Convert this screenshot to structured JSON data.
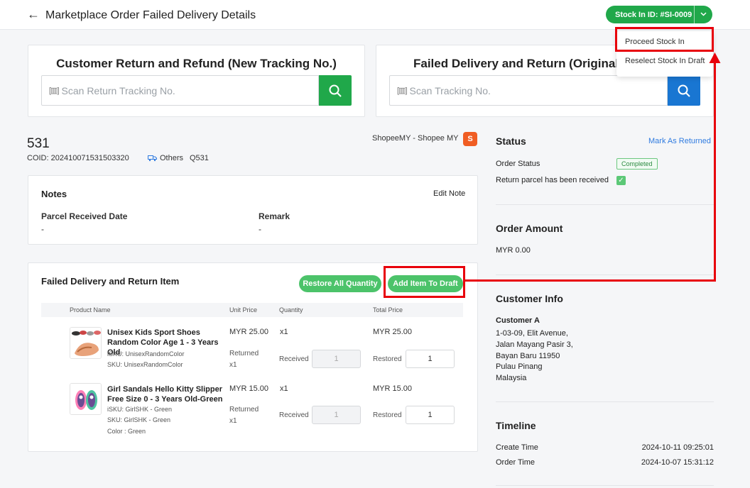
{
  "header": {
    "title": "Marketplace Order Failed Delivery Details",
    "stock_in_label": "Stock In ID: #SI-0009"
  },
  "dropdown": {
    "items": [
      "Proceed Stock In",
      "Reselect Stock In Draft"
    ]
  },
  "scan_left": {
    "title": "Customer Return and Refund (New Tracking No.)",
    "placeholder": "Scan Return Tracking No."
  },
  "scan_right": {
    "title": "Failed Delivery and Return (Original Tracking No.)",
    "placeholder": "Scan Tracking No."
  },
  "order": {
    "number": "531",
    "coid": "COID: 202410071531503320",
    "shipping": "Others",
    "ref": "Q531",
    "shop": "ShopeeMY - Shopee MY",
    "shop_icon_glyph": "S"
  },
  "notes": {
    "title": "Notes",
    "edit_label": "Edit Note",
    "parcel_date_label": "Parcel Received Date",
    "parcel_date_value": "-",
    "remark_label": "Remark",
    "remark_value": "-"
  },
  "items_section": {
    "title": "Failed Delivery and Return Item",
    "restore_all_label": "Restore All Quantity",
    "add_to_draft_label": "Add Item To Draft",
    "columns": [
      "Product Name",
      "Unit Price",
      "Quantity",
      "Total Price"
    ],
    "received_label": "Received",
    "restored_label": "Restored",
    "returned_label": "Returned",
    "products": [
      {
        "name": "Unisex Kids Sport Shoes Random Color Age 1 - 3 Years Old",
        "isku": "iSKU: UnisexRandomColor",
        "sku": "SKU: UnisexRandomColor",
        "color": "",
        "unit_price": "MYR 25.00",
        "quantity": "x1",
        "returned_qty": "x1",
        "total_price": "MYR 25.00",
        "received": "1",
        "restored": "1"
      },
      {
        "name": "Girl Sandals Hello Kitty Slipper Free Size 0 - 3 Years Old-Green",
        "isku": "iSKU: GirlSHK - Green",
        "sku": "SKU: GirlSHK - Green",
        "color": "Color : Green",
        "unit_price": "MYR 15.00",
        "quantity": "x1",
        "returned_qty": "x1",
        "total_price": "MYR 15.00",
        "received": "1",
        "restored": "1"
      }
    ]
  },
  "status": {
    "title": "Status",
    "mark_returned": "Mark As Returned",
    "order_status_label": "Order Status",
    "order_status_value": "Completed",
    "parcel_received_label": "Return parcel has been received",
    "check_glyph": "✓"
  },
  "order_amount": {
    "title": "Order Amount",
    "value": "MYR 0.00"
  },
  "customer": {
    "title": "Customer Info",
    "name": "Customer A",
    "address": [
      "1-03-09, Elit Avenue,",
      "Jalan Mayang Pasir 3,",
      "Bayan Baru 11950",
      "Pulau Pinang",
      "Malaysia"
    ]
  },
  "timeline": {
    "title": "Timeline",
    "create_label": "Create Time",
    "create_value": "2024-10-11 09:25:01",
    "order_label": "Order Time",
    "order_value": "2024-10-07 15:31:12"
  },
  "icons": {
    "back": "←",
    "caret": "⌄",
    "barcode": "[▥]"
  },
  "colors": {
    "primary_green": "#20a84a",
    "light_green": "#4cc36a",
    "scan_blue": "#1976d2",
    "highlight_red": "#e8000b",
    "link_blue": "#2f7be0"
  }
}
